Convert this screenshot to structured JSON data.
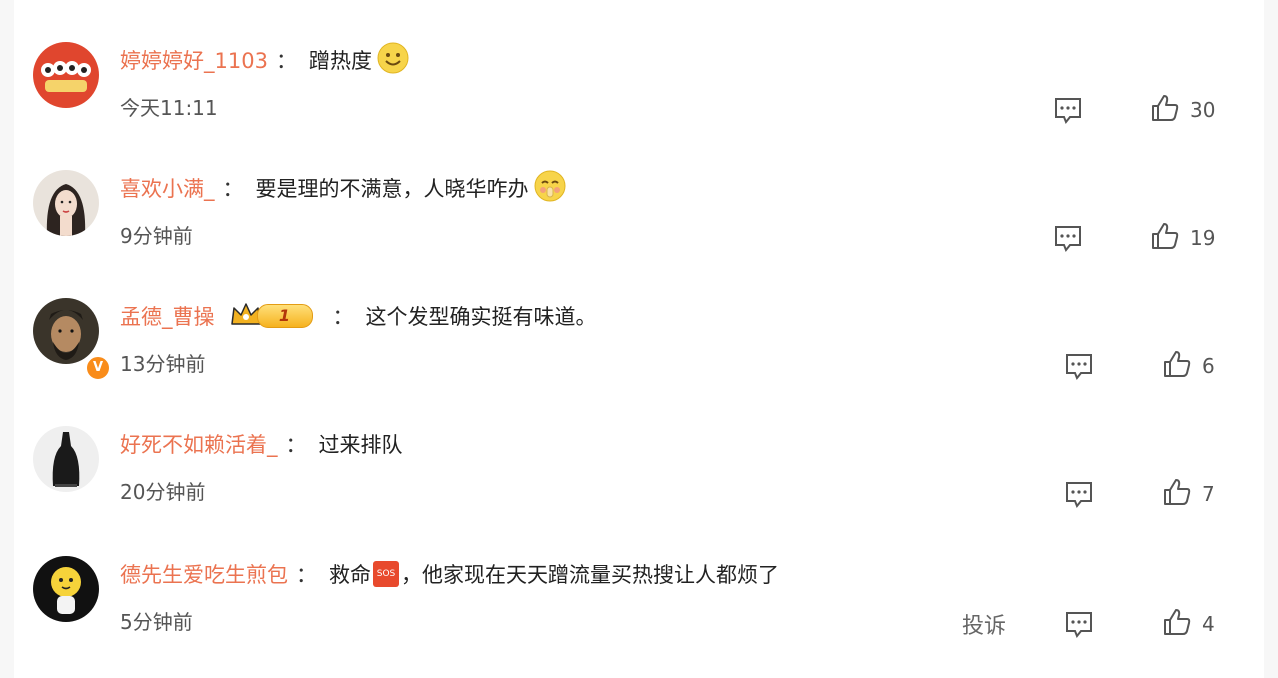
{
  "comments": [
    {
      "username": "婷婷婷好_1103",
      "colon": "：",
      "text": "蹭热度",
      "emoji": "smile-emoji",
      "time": "今天11:11",
      "likes": "30"
    },
    {
      "username": "喜欢小满_",
      "colon": "：",
      "text": "要是理的不满意，人晓华咋办",
      "emoji": "shy-emoji",
      "time": "9分钟前",
      "likes": "19"
    },
    {
      "username": "孟德_曹操",
      "colon": "：",
      "text": "这个发型确实挺有味道。",
      "vip_level": "1",
      "verified": "V",
      "time": "13分钟前",
      "likes": "6"
    },
    {
      "username": "好死不如赖活着_",
      "colon": "：",
      "text": "过来排队",
      "time": "20分钟前",
      "likes": "7"
    },
    {
      "username": "德先生爱吃生煎包",
      "colon": "：",
      "text_before": "救命",
      "inline_icon_label": "SOS",
      "text_after": "，他家现在天天蹭流量买热搜让人都烦了",
      "time": "5分钟前",
      "report": "投诉",
      "likes": "4"
    }
  ],
  "icons": {
    "reply": "comment-icon",
    "like": "thumbs-up-icon",
    "vip": "crown-icon"
  },
  "colors": {
    "username": "#eb7350",
    "text": "#222222",
    "meta": "#555555",
    "background": "#ffffff"
  }
}
